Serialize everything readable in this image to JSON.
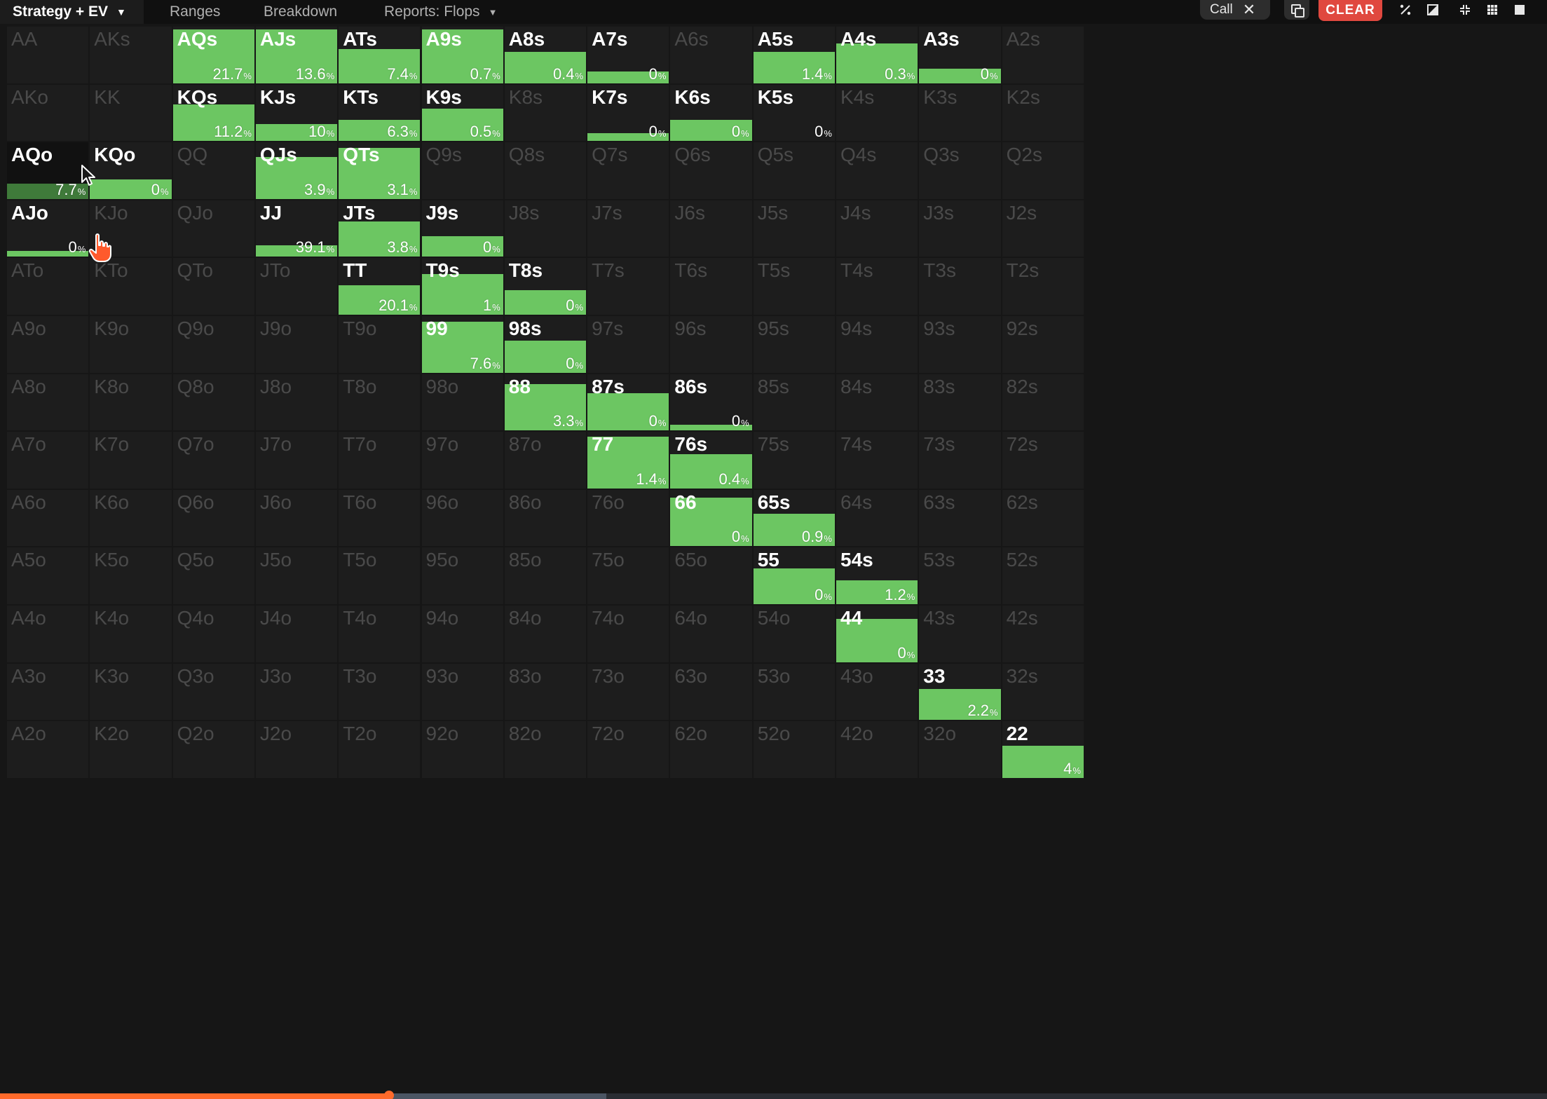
{
  "topbar": {
    "strategy_label": "Strategy + EV",
    "tabs": [
      {
        "label": "Ranges"
      },
      {
        "label": "Breakdown"
      },
      {
        "label": "Reports: Flops"
      }
    ],
    "action_pill": "Call",
    "clear_label": "CLEAR"
  },
  "colors": {
    "action_fill": "#6cc662",
    "cell_bg": "#1d1d1d",
    "inactive_text": "#4a4a4a",
    "clear_button": "#e0483f",
    "progress": "#ff6a2b"
  },
  "icons": [
    "copy-icon",
    "percent-icon",
    "contrast-icon",
    "compress-icon",
    "grid-icon",
    "square-icon",
    "close-icon",
    "chevron-down-icon"
  ],
  "ranks": [
    "A",
    "K",
    "Q",
    "J",
    "T",
    "9",
    "8",
    "7",
    "6",
    "5",
    "4",
    "3",
    "2"
  ],
  "hands": [
    {
      "hand": "AQs",
      "freq": 0.95,
      "pct": "21.7"
    },
    {
      "hand": "AJs",
      "freq": 0.95,
      "pct": "13.6"
    },
    {
      "hand": "ATs",
      "freq": 0.6,
      "pct": "7.4"
    },
    {
      "hand": "A9s",
      "freq": 0.95,
      "pct": "0.7"
    },
    {
      "hand": "A8s",
      "freq": 0.55,
      "pct": "0.4"
    },
    {
      "hand": "A7s",
      "freq": 0.2,
      "pct": "0"
    },
    {
      "hand": "A5s",
      "freq": 0.55,
      "pct": "1.4"
    },
    {
      "hand": "A4s",
      "freq": 0.7,
      "pct": "0.3"
    },
    {
      "hand": "A3s",
      "freq": 0.25,
      "pct": "0"
    },
    {
      "hand": "KQs",
      "freq": 0.65,
      "pct": "11.2"
    },
    {
      "hand": "KJs",
      "freq": 0.3,
      "pct": "10"
    },
    {
      "hand": "KTs",
      "freq": 0.37,
      "pct": "6.3"
    },
    {
      "hand": "K9s",
      "freq": 0.57,
      "pct": "0.5"
    },
    {
      "hand": "K7s",
      "freq": 0.14,
      "pct": "0"
    },
    {
      "hand": "K6s",
      "freq": 0.37,
      "pct": "0"
    },
    {
      "hand": "K5s",
      "freq": 0.0,
      "pct": "0"
    },
    {
      "hand": "AQo",
      "freq": 0.27,
      "pct": "7.7",
      "dark": true
    },
    {
      "hand": "KQo",
      "freq": 0.34,
      "pct": "0"
    },
    {
      "hand": "QJs",
      "freq": 0.74,
      "pct": "3.9"
    },
    {
      "hand": "QTs",
      "freq": 0.9,
      "pct": "3.1"
    },
    {
      "hand": "AJo",
      "freq": 0.1,
      "pct": "0"
    },
    {
      "hand": "JJ",
      "freq": 0.2,
      "pct": "39.1"
    },
    {
      "hand": "JTs",
      "freq": 0.62,
      "pct": "3.8"
    },
    {
      "hand": "J9s",
      "freq": 0.37,
      "pct": "0"
    },
    {
      "hand": "TT",
      "freq": 0.52,
      "pct": "20.1"
    },
    {
      "hand": "T9s",
      "freq": 0.72,
      "pct": "1"
    },
    {
      "hand": "T8s",
      "freq": 0.43,
      "pct": "0"
    },
    {
      "hand": "99",
      "freq": 0.9,
      "pct": "7.6"
    },
    {
      "hand": "98s",
      "freq": 0.56,
      "pct": "0"
    },
    {
      "hand": "88",
      "freq": 0.82,
      "pct": "3.3"
    },
    {
      "hand": "87s",
      "freq": 0.66,
      "pct": "0"
    },
    {
      "hand": "86s",
      "freq": 0.1,
      "pct": "0"
    },
    {
      "hand": "77",
      "freq": 0.92,
      "pct": "1.4"
    },
    {
      "hand": "76s",
      "freq": 0.61,
      "pct": "0.4"
    },
    {
      "hand": "66",
      "freq": 0.86,
      "pct": "0"
    },
    {
      "hand": "65s",
      "freq": 0.58,
      "pct": "0.9"
    },
    {
      "hand": "55",
      "freq": 0.63,
      "pct": "0"
    },
    {
      "hand": "54s",
      "freq": 0.42,
      "pct": "1.2"
    },
    {
      "hand": "44",
      "freq": 0.76,
      "pct": "0"
    },
    {
      "hand": "33",
      "freq": 0.55,
      "pct": "2.2"
    },
    {
      "hand": "22",
      "freq": 0.57,
      "pct": "4"
    }
  ],
  "progress": 0.25
}
